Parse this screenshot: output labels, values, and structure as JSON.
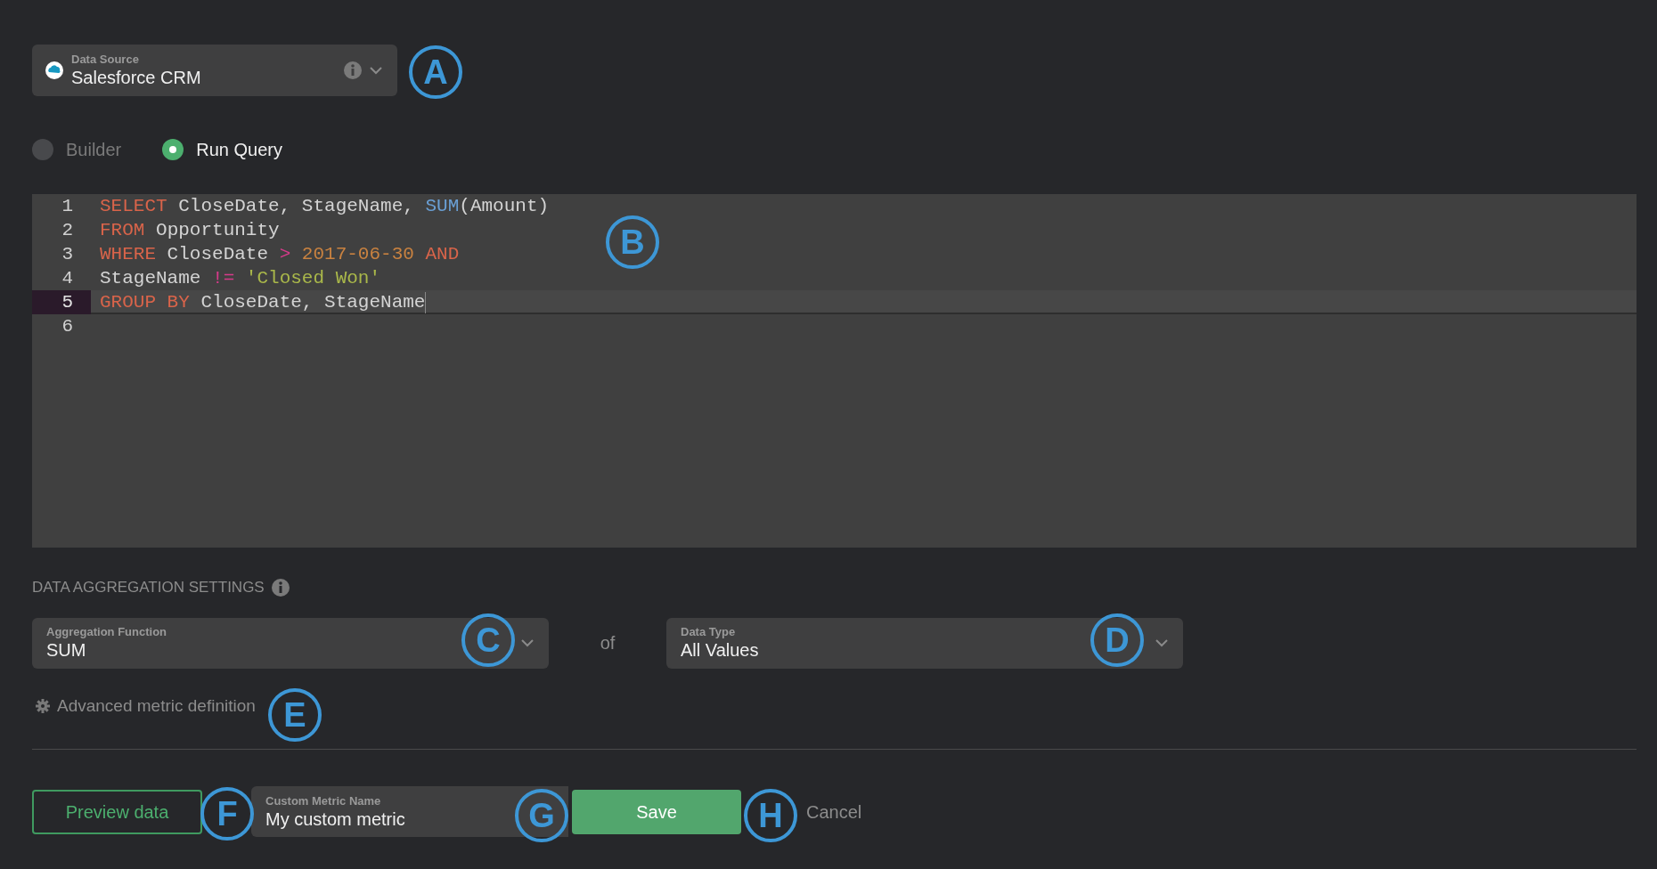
{
  "data_source": {
    "label": "Data Source",
    "value": "Salesforce CRM"
  },
  "query_mode": [
    {
      "label": "Builder",
      "selected": false
    },
    {
      "label": "Run Query",
      "selected": true
    }
  ],
  "editor": {
    "lines": [
      {
        "number": "1",
        "active": false,
        "tokens": [
          {
            "kind": "keyword",
            "text": "SELECT"
          },
          {
            "kind": "plain",
            "text": " CloseDate, StageName, "
          },
          {
            "kind": "function",
            "text": "SUM"
          },
          {
            "kind": "plain",
            "text": "(Amount)"
          }
        ]
      },
      {
        "number": "2",
        "active": false,
        "tokens": [
          {
            "kind": "keyword",
            "text": "FROM"
          },
          {
            "kind": "plain",
            "text": " Opportunity"
          }
        ]
      },
      {
        "number": "3",
        "active": false,
        "tokens": [
          {
            "kind": "keyword",
            "text": "WHERE"
          },
          {
            "kind": "plain",
            "text": " CloseDate "
          },
          {
            "kind": "operator",
            "text": ">"
          },
          {
            "kind": "number",
            "text": " 2017-06-30"
          },
          {
            "kind": "keyword",
            "text": " AND"
          }
        ]
      },
      {
        "number": "4",
        "active": false,
        "tokens": [
          {
            "kind": "plain",
            "text": "StageName "
          },
          {
            "kind": "operator",
            "text": "!="
          },
          {
            "kind": "string",
            "text": " 'Closed Won'"
          }
        ]
      },
      {
        "number": "5",
        "active": true,
        "tokens": [
          {
            "kind": "keyword",
            "text": "GROUP BY"
          },
          {
            "kind": "plain",
            "text": " CloseDate, StageName"
          }
        ]
      },
      {
        "number": "6",
        "active": false
      }
    ]
  },
  "aggregation": {
    "heading": "DATA AGGREGATION SETTINGS",
    "function": {
      "label": "Aggregation Function",
      "value": "SUM"
    },
    "connector": "of",
    "data_type": {
      "label": "Data Type",
      "value": "All Values"
    },
    "advanced_link": "Advanced metric definition"
  },
  "footer": {
    "preview_button": "Preview data",
    "name_field": {
      "label": "Custom Metric Name",
      "value": "My custom metric"
    },
    "save_button": "Save",
    "cancel_link": "Cancel"
  },
  "callouts": [
    {
      "letter": "A"
    },
    {
      "letter": "B"
    },
    {
      "letter": "C"
    },
    {
      "letter": "D"
    },
    {
      "letter": "E"
    },
    {
      "letter": "F"
    },
    {
      "letter": "G"
    },
    {
      "letter": "H"
    }
  ]
}
